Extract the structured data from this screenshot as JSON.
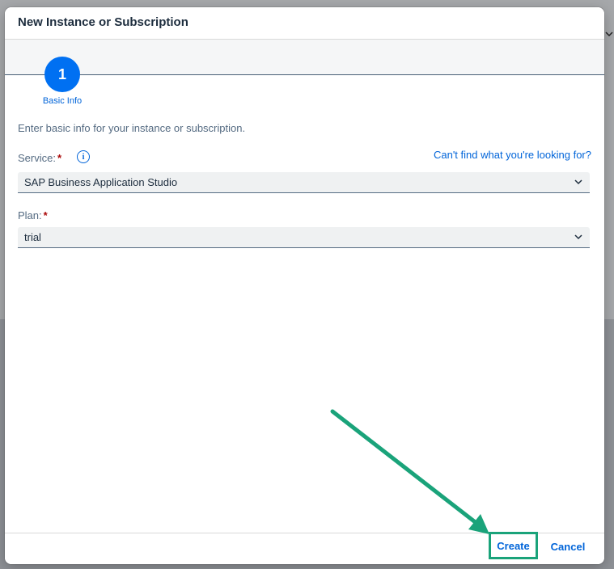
{
  "dialog": {
    "title": "New Instance or Subscription"
  },
  "wizard": {
    "step_number": "1",
    "step_label": "Basic Info"
  },
  "form": {
    "intro": "Enter basic info for your instance or subscription.",
    "service_label": "Service:",
    "service_required": "*",
    "service_value": "SAP Business Application Studio",
    "help_link": "Can't find what you're looking for?",
    "plan_label": "Plan:",
    "plan_required": "*",
    "plan_value": "trial"
  },
  "footer": {
    "create_label": "Create",
    "cancel_label": "Cancel"
  },
  "colors": {
    "accent": "#0070f2",
    "link": "#0064d9",
    "highlight": "#1aa37a",
    "required": "#aa0808"
  }
}
